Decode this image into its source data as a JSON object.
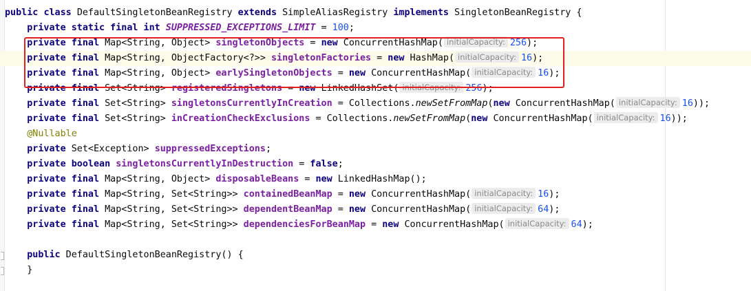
{
  "code": {
    "class_decl": {
      "kw_public": "public",
      "kw_class": "class",
      "class_name": "DefaultSingletonBeanRegistry",
      "kw_extends": "extends",
      "super_class": "SimpleAliasRegistry",
      "kw_implements": "implements",
      "iface": "SingletonBeanRegistry",
      "brace": "{"
    },
    "lines": [
      {
        "mods": "private static final int",
        "name": "SUPPRESSED_EXCEPTIONS_LIMIT",
        "assign": " = ",
        "value": "100",
        "end": ";"
      },
      {
        "mods": "private final",
        "type": " Map<String, Object> ",
        "name": "singletonObjects",
        "assign": " = ",
        "kw_new": "new",
        "ctor": " ConcurrentHashMap(",
        "hint": "initialCapacity:",
        "arg": "256",
        "end": ");"
      },
      {
        "mods": "private final",
        "type": " Map<String, ObjectFactory<?>> ",
        "name": "singletonFactories",
        "assign": " = ",
        "kw_new": "new",
        "ctor": " HashMap(",
        "hint": "initialCapacity:",
        "arg": "16",
        "end": ");"
      },
      {
        "mods": "private final",
        "type": " Map<String, Object> ",
        "name": "earlySingletonObjects",
        "assign": " = ",
        "kw_new": "new",
        "ctor": " ConcurrentHashMap(",
        "hint": "initialCapacity:",
        "arg": "16",
        "end": ");"
      },
      {
        "mods": "private final",
        "type": " Set<String> ",
        "name": "registeredSingletons",
        "assign": " = ",
        "kw_new": "new",
        "ctor": " LinkedHashSet(",
        "hint": "initialCapacity:",
        "arg": "256",
        "end": ");"
      },
      {
        "mods": "private final",
        "type": " Set<String> ",
        "name": "singletonsCurrentlyInCreation",
        "assign": " = Collections.",
        "method": "newSetFromMap",
        "open": "(",
        "kw_new": "new",
        "ctor": " ConcurrentHashMap(",
        "hint": "initialCapacity:",
        "arg": "16",
        "end": "));"
      },
      {
        "mods": "private final",
        "type": " Set<String> ",
        "name": "inCreationCheckExclusions",
        "assign": " = Collections.",
        "method": "newSetFromMap",
        "open": "(",
        "kw_new": "new",
        "ctor": " ConcurrentHashMap(",
        "hint": "initialCapacity:",
        "arg": "16",
        "end": "));"
      },
      {
        "annotation": "@Nullable"
      },
      {
        "mods": "private",
        "type": " Set<Exception> ",
        "name": "suppressedExceptions",
        "end": ";"
      },
      {
        "mods": "private boolean",
        "name": "singletonsCurrentlyInDestruction",
        "assign": " = ",
        "kw_value": "false",
        "end": ";"
      },
      {
        "mods": "private final",
        "type": " Map<String, Object> ",
        "name": "disposableBeans",
        "assign": " = ",
        "kw_new": "new",
        "ctor": " LinkedHashMap();"
      },
      {
        "mods": "private final",
        "type": " Map<String, Set<String>> ",
        "name": "containedBeanMap",
        "assign": " = ",
        "kw_new": "new",
        "ctor": " ConcurrentHashMap(",
        "hint": "initialCapacity:",
        "arg": "16",
        "end": ");"
      },
      {
        "mods": "private final",
        "type": " Map<String, Set<String>> ",
        "name": "dependentBeanMap",
        "assign": " = ",
        "kw_new": "new",
        "ctor": " ConcurrentHashMap(",
        "hint": "initialCapacity:",
        "arg": "64",
        "end": ");"
      },
      {
        "mods": "private final",
        "type": " Map<String, Set<String>> ",
        "name": "dependenciesForBeanMap",
        "assign": " = ",
        "kw_new": "new",
        "ctor": " ConcurrentHashMap(",
        "hint": "initialCapacity:",
        "arg": "64",
        "end": ");"
      }
    ],
    "ctor_decl": {
      "kw_public": "public",
      "sig": " DefaultSingletonBeanRegistry() {",
      "close": "}"
    }
  },
  "colors": {
    "keyword": "#0a0080",
    "field": "#7b1fa2",
    "number": "#1750eb",
    "annotation": "#808000",
    "highlight_box": "#e02020",
    "current_line": "#fcfae8"
  }
}
